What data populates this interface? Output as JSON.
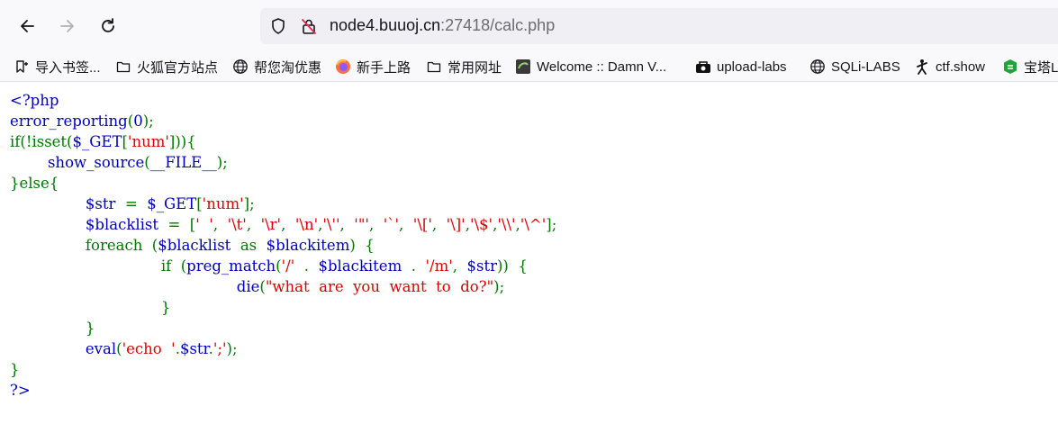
{
  "browser": {
    "url_host": "node4.buuoj.cn",
    "url_rest": ":27418/calc.php"
  },
  "bookmarks": [
    {
      "label": "导入书签...",
      "icon": "bookmark-import-icon"
    },
    {
      "label": "火狐官方站点",
      "icon": "folder-icon"
    },
    {
      "label": "帮您淘优惠",
      "icon": "globe-icon"
    },
    {
      "label": "新手上路",
      "icon": "firefox-icon"
    },
    {
      "label": "常用网址",
      "icon": "folder-icon"
    },
    {
      "label": "Welcome :: Damn V...",
      "icon": "dvwa-icon"
    },
    {
      "label": "upload-labs",
      "icon": "upload-labs-icon"
    },
    {
      "label": "SQLi-LABS",
      "icon": "globe-icon"
    },
    {
      "label": "ctf.show",
      "icon": "ctfshow-icon"
    },
    {
      "label": "宝塔L",
      "icon": "baota-icon"
    }
  ],
  "colors": {
    "keyword": "#007700",
    "string": "#dd0000",
    "default": "#0000bb"
  },
  "source_lines": [
    [
      [
        "b",
        "<?php"
      ]
    ],
    [
      [
        "b",
        "error_reporting"
      ],
      [
        "g",
        "("
      ],
      [
        "b",
        "0"
      ],
      [
        "g",
        ");"
      ]
    ],
    [
      [
        "g",
        "if(!isset("
      ],
      [
        "b",
        "$_GET"
      ],
      [
        "g",
        "["
      ],
      [
        "r",
        "'num'"
      ],
      [
        "g",
        "])){"
      ]
    ],
    [
      [
        "g",
        "        "
      ],
      [
        "b",
        "show_source"
      ],
      [
        "g",
        "("
      ],
      [
        "b",
        "__FILE__"
      ],
      [
        "g",
        ");"
      ]
    ],
    [
      [
        "g",
        "}else{"
      ]
    ],
    [
      [
        "g",
        "                "
      ],
      [
        "b",
        "$str  "
      ],
      [
        "g",
        "=  "
      ],
      [
        "b",
        "$_GET"
      ],
      [
        "g",
        "["
      ],
      [
        "r",
        "'num'"
      ],
      [
        "g",
        "];"
      ]
    ],
    [
      [
        "g",
        "                "
      ],
      [
        "b",
        "$blacklist  "
      ],
      [
        "g",
        "=  ["
      ],
      [
        "r",
        "'  '"
      ],
      [
        "g",
        ",  "
      ],
      [
        "r",
        "'\\t'"
      ],
      [
        "g",
        ",  "
      ],
      [
        "r",
        "'\\r'"
      ],
      [
        "g",
        ",  "
      ],
      [
        "r",
        "'\\n'"
      ],
      [
        "g",
        ","
      ],
      [
        "r",
        "'\\''"
      ],
      [
        "g",
        ",  "
      ],
      [
        "r",
        "'\"'"
      ],
      [
        "g",
        ",  "
      ],
      [
        "r",
        "'`'"
      ],
      [
        "g",
        ",  "
      ],
      [
        "r",
        "'\\['"
      ],
      [
        "g",
        ",  "
      ],
      [
        "r",
        "'\\]'"
      ],
      [
        "g",
        ","
      ],
      [
        "r",
        "'\\$'"
      ],
      [
        "g",
        ","
      ],
      [
        "r",
        "'\\\\'"
      ],
      [
        "g",
        ","
      ],
      [
        "r",
        "'\\^'"
      ],
      [
        "g",
        "];"
      ]
    ],
    [
      [
        "g",
        "                foreach  ("
      ],
      [
        "b",
        "$blacklist  "
      ],
      [
        "g",
        "as  "
      ],
      [
        "b",
        "$blackitem"
      ],
      [
        "g",
        ")  {"
      ]
    ],
    [
      [
        "g",
        "                                if  ("
      ],
      [
        "b",
        "preg_match"
      ],
      [
        "g",
        "("
      ],
      [
        "r",
        "'/'  "
      ],
      [
        "g",
        ".  "
      ],
      [
        "b",
        "$blackitem  "
      ],
      [
        "g",
        ".  "
      ],
      [
        "r",
        "'/m'"
      ],
      [
        "g",
        ",  "
      ],
      [
        "b",
        "$str"
      ],
      [
        "g",
        "))  {"
      ]
    ],
    [
      [
        "g",
        "                                                "
      ],
      [
        "b",
        "die"
      ],
      [
        "g",
        "("
      ],
      [
        "r",
        "\"what  are  you  want  to  do?\""
      ],
      [
        "g",
        ");"
      ]
    ],
    [
      [
        "g",
        "                                }"
      ]
    ],
    [
      [
        "g",
        "                }"
      ]
    ],
    [
      [
        "g",
        "                "
      ],
      [
        "b",
        "eval"
      ],
      [
        "g",
        "("
      ],
      [
        "r",
        "'echo  '"
      ],
      [
        "g",
        "."
      ],
      [
        "b",
        "$str"
      ],
      [
        "g",
        "."
      ],
      [
        "r",
        "';'"
      ],
      [
        "g",
        ");"
      ]
    ],
    [
      [
        "g",
        "}"
      ]
    ],
    [
      [
        "b",
        "?>"
      ]
    ]
  ]
}
